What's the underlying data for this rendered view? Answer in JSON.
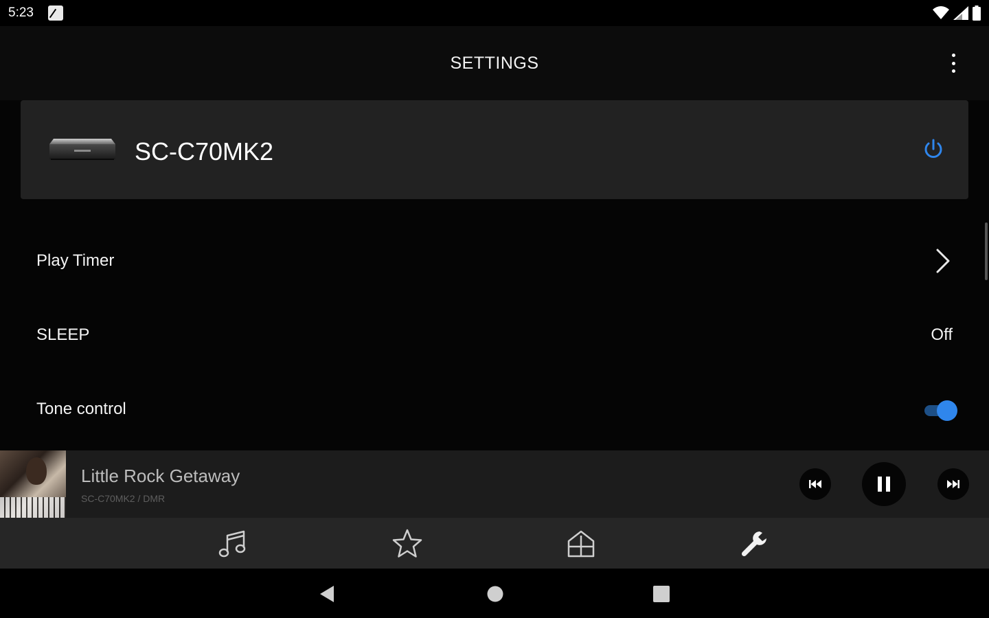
{
  "status_bar": {
    "time": "5:23",
    "icons": [
      "sd-card-icon",
      "wifi-icon",
      "cell-signal-icon",
      "battery-icon"
    ]
  },
  "header": {
    "title": "SETTINGS",
    "menu_icon": "more-vert-icon"
  },
  "device": {
    "name": "SC-C70MK2",
    "image_icon": "stereo-system-icon",
    "power_icon": "power-icon",
    "power_color": "#2f86ec"
  },
  "settings": [
    {
      "label": "Play Timer",
      "type": "link",
      "icon": "chevron-right-icon"
    },
    {
      "label": "SLEEP",
      "type": "value",
      "value": "Off"
    },
    {
      "label": "Tone control",
      "type": "toggle",
      "on": true
    }
  ],
  "now_playing": {
    "title": "Little Rock Getaway",
    "source": "SC-C70MK2  / DMR",
    "controls": [
      "skip-previous-icon",
      "pause-icon",
      "skip-next-icon"
    ]
  },
  "bottom_nav": {
    "items": [
      "music-note-icon",
      "star-icon",
      "home-icon",
      "wrench-icon"
    ],
    "active": "wrench-icon"
  },
  "system_nav": [
    "back-icon",
    "home-circle-icon",
    "recents-icon"
  ],
  "colors": {
    "accent": "#2f86ec",
    "background": "#000000",
    "card": "#222222"
  }
}
